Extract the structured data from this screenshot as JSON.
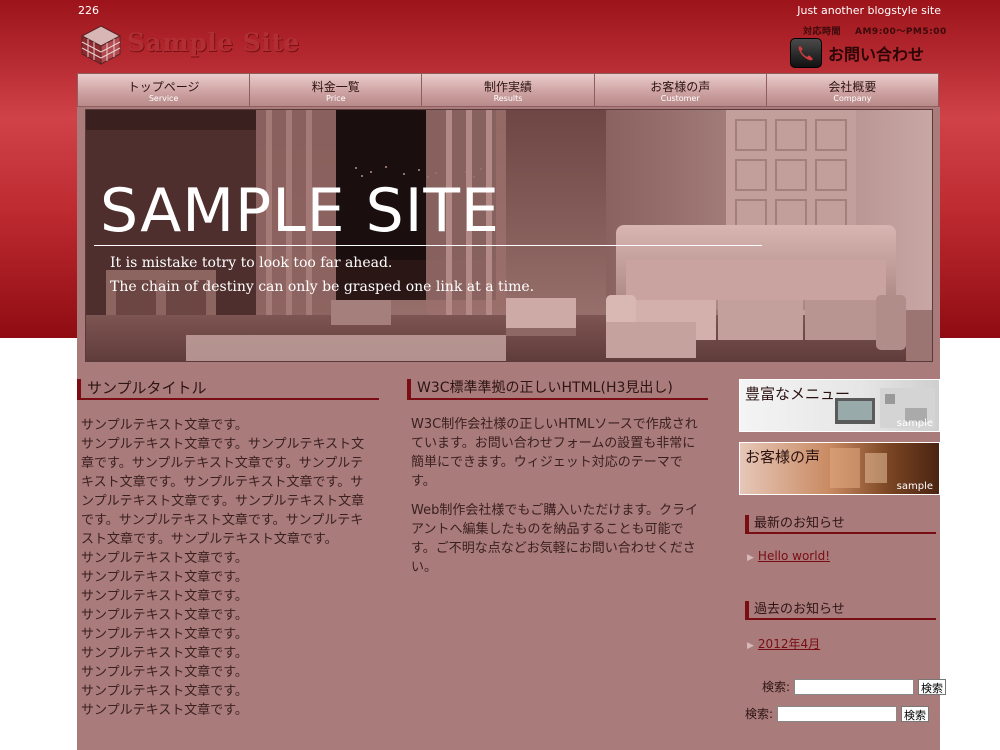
{
  "header": {
    "id_text": "226",
    "tagline": "Just another blogstyle site",
    "logo_text": "Sample Site",
    "hours_label": "対応時間",
    "hours_value": "AM9:00〜PM5:00",
    "contact_label": "お問い合わせ"
  },
  "nav": {
    "items": [
      {
        "jp": "トップページ",
        "en": "Service"
      },
      {
        "jp": "料金一覧",
        "en": "Price"
      },
      {
        "jp": "制作実績",
        "en": "Results"
      },
      {
        "jp": "お客様の声",
        "en": "Customer"
      },
      {
        "jp": "会社概要",
        "en": "Company"
      }
    ]
  },
  "hero": {
    "title": "SAMPLE SITE",
    "line1": "It is mistake totry to look too far ahead.",
    "line2": "The chain of destiny can only be grasped one link at a time."
  },
  "left": {
    "title": "サンプルタイトル",
    "lines": [
      "サンプルテキスト文章です。",
      "サンプルテキスト文章です。サンプルテキスト文",
      "章です。サンプルテキスト文章です。サンプルテ",
      "キスト文章です。サンプルテキスト文章です。サ",
      "ンプルテキスト文章です。サンプルテキスト文章",
      "です。サンプルテキスト文章です。サンプルテキ",
      "スト文章です。サンプルテキスト文章です。",
      "サンプルテキスト文章です。",
      "サンプルテキスト文章です。",
      "サンプルテキスト文章です。",
      "サンプルテキスト文章です。",
      "サンプルテキスト文章です。",
      "サンプルテキスト文章です。",
      "サンプルテキスト文章です。",
      "サンプルテキスト文章です。",
      "サンプルテキスト文章です。"
    ]
  },
  "middle": {
    "title": "W3C標準準拠の正しいHTML(H3見出し)",
    "para1": "W3C制作会社様の正しいHTMLソースで作成されています。お問い合わせフォームの設置も非常に簡単にできます。ウィジェット対応のテーマです。",
    "para2": "Web制作会社様でもご購入いただけます。クライアントへ編集したものを納品することも可能です。ご不明な点などお気軽にお問い合わせください。"
  },
  "sidebar": {
    "banner1": {
      "label": "豊富なメニュー",
      "tag": "sample"
    },
    "banner2": {
      "label": "お客様の声",
      "tag": "sample"
    },
    "latest_title": "最新のお知らせ",
    "latest_link": "Hello world!",
    "past_title": "過去のお知らせ",
    "past_link": "2012年4月",
    "search1": {
      "label": "検索:",
      "button": "検索",
      "value": ""
    },
    "search2": {
      "label": "検索:",
      "button": "検索",
      "value": ""
    }
  }
}
